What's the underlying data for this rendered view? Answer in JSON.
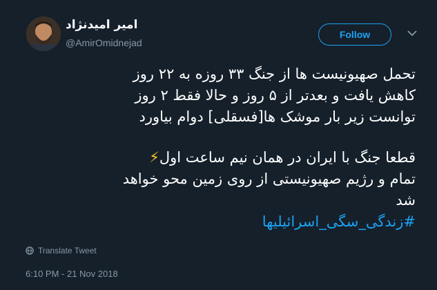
{
  "user": {
    "display_name": "امیر امیدنژاد",
    "handle": "@AmirOmidnejad"
  },
  "follow_label": "Follow",
  "tweet": {
    "lines_part1": [
      "تحمل صهیونیست ها از جنگ ۳۳ روزه به ۲۲ روز",
      "کاهش یافت و بعدتر از ۵ روز و حالا فقط ۲ روز",
      "توانست زیر بار موشک ها[فسقلی] دوام بیاورد"
    ],
    "bolt_emoji": "⚡",
    "lines_part2": [
      "قطعا جنگ با ایران در همان نیم ساعت اول",
      "تمام و رژیم صهیونیستی از روی زمین محو خواهد",
      "شد"
    ],
    "hashtag": "#زندگی_سگی_اسرائیلیها"
  },
  "translate_label": "Translate Tweet",
  "timestamp": "6:10 PM - 21 Nov 2018",
  "colors": {
    "background": "#15202b",
    "accent": "#1da1f2",
    "muted": "#8899a6"
  }
}
